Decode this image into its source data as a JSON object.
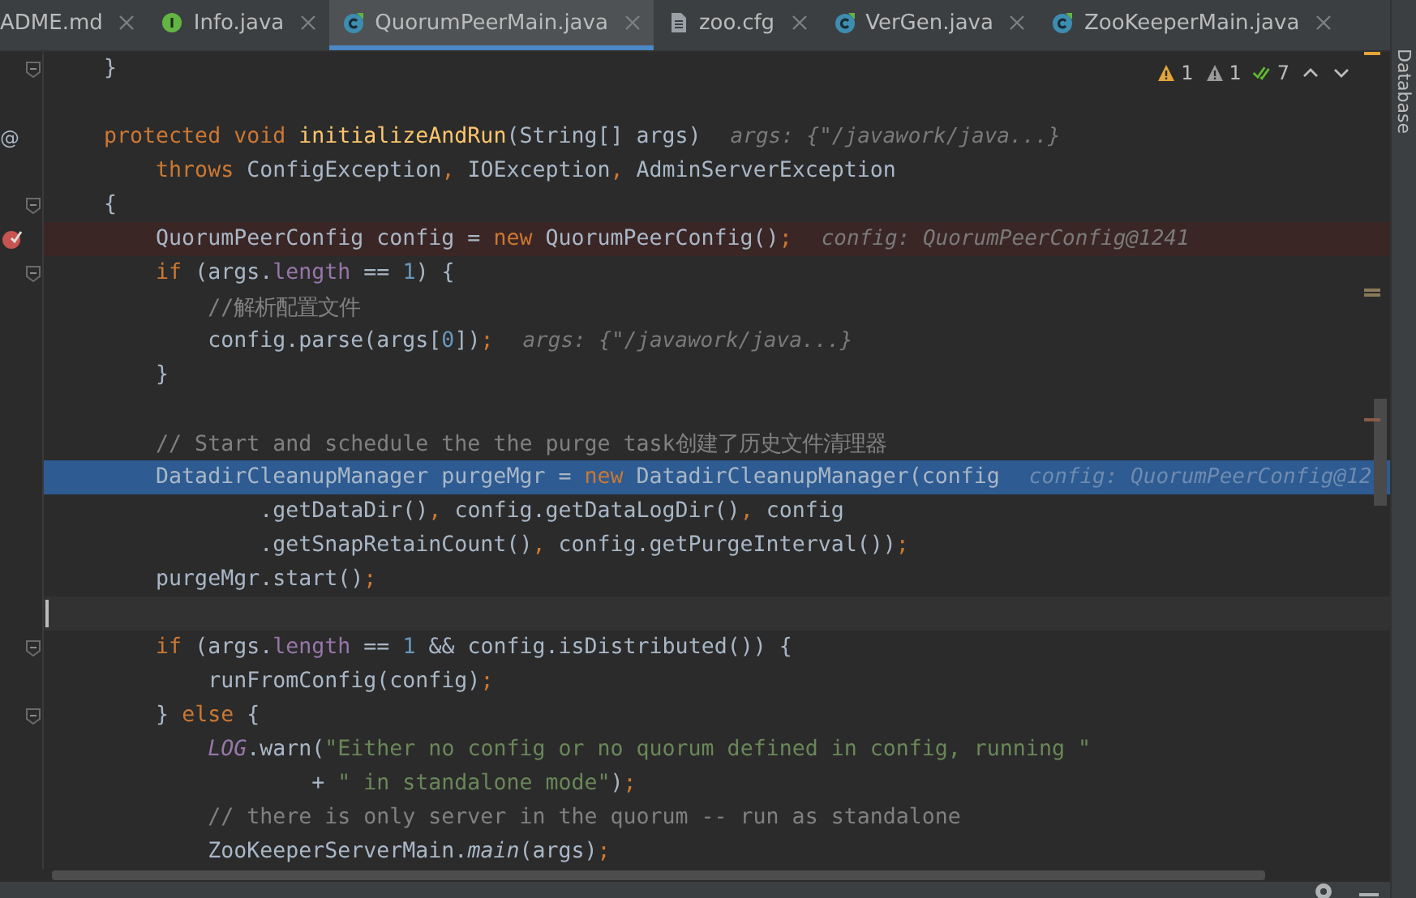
{
  "tabs": [
    {
      "label": "ADME.md",
      "kind": "none",
      "selected": false
    },
    {
      "label": "Info.java",
      "kind": "interface",
      "selected": false
    },
    {
      "label": "QuorumPeerMain.java",
      "kind": "class",
      "selected": true
    },
    {
      "label": "zoo.cfg",
      "kind": "file",
      "selected": false
    },
    {
      "label": "VerGen.java",
      "kind": "class",
      "selected": false
    },
    {
      "label": "ZooKeeperMain.java",
      "kind": "class",
      "selected": false
    }
  ],
  "side_panel": {
    "label": "Database"
  },
  "inspections": [
    {
      "kind": "warning",
      "count": "1"
    },
    {
      "kind": "weak_warning",
      "count": "1"
    },
    {
      "kind": "typo",
      "count": "7"
    }
  ],
  "lines": [
    {
      "gutter": {
        "kind": "fold"
      },
      "tokens": [
        {
          "kind": "plain",
          "text": "    }"
        }
      ]
    },
    {
      "kind": "blank"
    },
    {
      "gutter": {
        "kind": "override",
        "text": "@"
      },
      "tokens": [
        {
          "kind": "keyword",
          "text": "    protected void "
        },
        {
          "kind": "method",
          "text": "initializeAndRun"
        },
        {
          "kind": "plain",
          "text": "(String[] args)"
        }
      ],
      "hint": "args: {\"/javawork/java...}"
    },
    {
      "tokens": [
        {
          "kind": "keyword",
          "text": "        throws "
        },
        {
          "kind": "plain",
          "text": "ConfigException"
        },
        {
          "kind": "keyword",
          "text": ", "
        },
        {
          "kind": "plain",
          "text": "IOException"
        },
        {
          "kind": "keyword",
          "text": ", "
        },
        {
          "kind": "plain",
          "text": "AdminServerException"
        }
      ]
    },
    {
      "gutter": {
        "kind": "fold"
      },
      "tokens": [
        {
          "kind": "plain",
          "text": "    {"
        }
      ]
    },
    {
      "gutter": {
        "kind": "breakpoint"
      },
      "kind": "breakpoint",
      "tokens": [
        {
          "kind": "plain",
          "text": "        QuorumPeerConfig config = "
        },
        {
          "kind": "keyword",
          "text": "new "
        },
        {
          "kind": "plain",
          "text": "QuorumPeerConfig()"
        },
        {
          "kind": "keyword",
          "text": ";"
        }
      ],
      "hint": "config: QuorumPeerConfig@1241"
    },
    {
      "gutter": {
        "kind": "fold"
      },
      "tokens": [
        {
          "kind": "keyword",
          "text": "        if "
        },
        {
          "kind": "plain",
          "text": "(args."
        },
        {
          "kind": "field",
          "text": "length"
        },
        {
          "kind": "plain",
          "text": " == "
        },
        {
          "kind": "number",
          "text": "1"
        },
        {
          "kind": "plain",
          "text": ") {"
        }
      ]
    },
    {
      "tokens": [
        {
          "kind": "comment",
          "text": "            //解析配置文件"
        }
      ]
    },
    {
      "tokens": [
        {
          "kind": "plain",
          "text": "            config.parse(args["
        },
        {
          "kind": "number",
          "text": "0"
        },
        {
          "kind": "plain",
          "text": "])"
        },
        {
          "kind": "keyword",
          "text": ";"
        }
      ],
      "hint": "args: {\"/javawork/java...}"
    },
    {
      "tokens": [
        {
          "kind": "plain",
          "text": "        }"
        }
      ]
    },
    {
      "kind": "blank"
    },
    {
      "tokens": [
        {
          "kind": "comment",
          "text": "        // Start and schedule the the purge task创建了历史文件清理器"
        }
      ]
    },
    {
      "kind": "execution",
      "tokens": [
        {
          "kind": "plain",
          "text": "        DatadirCleanupManager purgeMgr = "
        },
        {
          "kind": "keyword",
          "text": "new "
        },
        {
          "kind": "plain",
          "text": "DatadirCleanupManager(config"
        }
      ],
      "hint": "config: QuorumPeerConfig@12"
    },
    {
      "tokens": [
        {
          "kind": "plain",
          "text": "                .getDataDir()"
        },
        {
          "kind": "keyword",
          "text": ", "
        },
        {
          "kind": "plain",
          "text": "config.getDataLogDir()"
        },
        {
          "kind": "keyword",
          "text": ", "
        },
        {
          "kind": "plain",
          "text": "config"
        }
      ]
    },
    {
      "tokens": [
        {
          "kind": "plain",
          "text": "                .getSnapRetainCount()"
        },
        {
          "kind": "keyword",
          "text": ", "
        },
        {
          "kind": "plain",
          "text": "config.getPurgeInterval())"
        },
        {
          "kind": "keyword",
          "text": ";"
        }
      ]
    },
    {
      "tokens": [
        {
          "kind": "plain",
          "text": "        purgeMgr.start()"
        },
        {
          "kind": "keyword",
          "text": ";"
        }
      ]
    },
    {
      "kind": "caret"
    },
    {
      "gutter": {
        "kind": "fold"
      },
      "tokens": [
        {
          "kind": "keyword",
          "text": "        if "
        },
        {
          "kind": "plain",
          "text": "(args."
        },
        {
          "kind": "field",
          "text": "length"
        },
        {
          "kind": "plain",
          "text": " == "
        },
        {
          "kind": "number",
          "text": "1"
        },
        {
          "kind": "plain",
          "text": " && config.isDistributed()) {"
        }
      ]
    },
    {
      "tokens": [
        {
          "kind": "plain",
          "text": "            runFromConfig(config)"
        },
        {
          "kind": "keyword",
          "text": ";"
        }
      ]
    },
    {
      "gutter": {
        "kind": "fold"
      },
      "tokens": [
        {
          "kind": "plain",
          "text": "        } "
        },
        {
          "kind": "keyword",
          "text": "else "
        },
        {
          "kind": "plain",
          "text": "{"
        }
      ]
    },
    {
      "tokens": [
        {
          "kind": "static_field",
          "text": "            LOG"
        },
        {
          "kind": "plain",
          "text": ".warn("
        },
        {
          "kind": "string",
          "text": "\"Either no config or no quorum defined in config, running \""
        }
      ]
    },
    {
      "tokens": [
        {
          "kind": "plain",
          "text": "                    + "
        },
        {
          "kind": "string",
          "text": "\" in standalone mode\""
        },
        {
          "kind": "plain",
          "text": ")"
        },
        {
          "kind": "keyword",
          "text": ";"
        }
      ]
    },
    {
      "tokens": [
        {
          "kind": "comment",
          "text": "            // there is only server in the quorum -- run as standalone"
        }
      ]
    },
    {
      "tokens": [
        {
          "kind": "plain",
          "text": "            ZooKeeperServerMain."
        },
        {
          "kind": "static_call",
          "text": "main"
        },
        {
          "kind": "plain",
          "text": "(args)"
        },
        {
          "kind": "keyword",
          "text": ";"
        }
      ]
    }
  ]
}
